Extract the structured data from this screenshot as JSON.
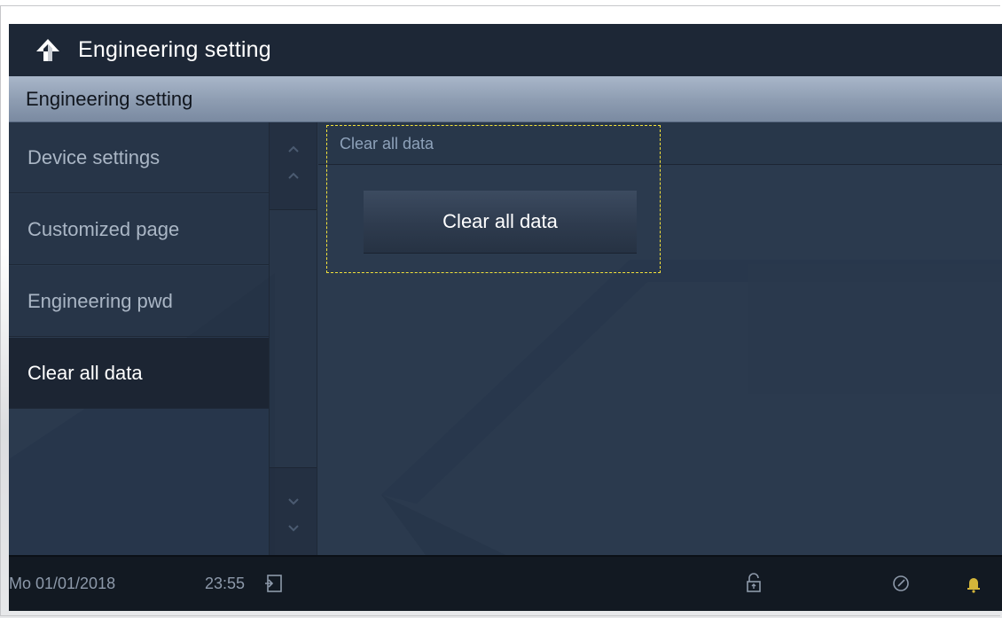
{
  "header": {
    "title": "Engineering setting",
    "back_icon": "back-arrow-icon"
  },
  "subheader": {
    "label": "Engineering setting"
  },
  "sidebar": {
    "items": [
      {
        "label": "Device settings",
        "active": false
      },
      {
        "label": "Customized page",
        "active": false
      },
      {
        "label": "Engineering pwd",
        "active": false
      },
      {
        "label": "Clear all data",
        "active": true
      }
    ]
  },
  "scrollbar": {
    "up_icon": "chevron-up-icon",
    "down_icon": "chevron-down-icon"
  },
  "panel": {
    "header": "Clear all data",
    "button_label": "Clear all data",
    "highlight_color": "#f4e23a"
  },
  "statusbar": {
    "date": "Mo 01/01/2018",
    "time": "23:55",
    "icons": [
      "exit-icon",
      "unlock-icon",
      "clock-icon",
      "bell-icon"
    ]
  },
  "colors": {
    "title_bg": "#1d2736",
    "content_bg": "#2b3a4e",
    "subheader_bg": "#8d9cb1",
    "status_bg": "#121922",
    "active_item_bg": "#1c2533"
  }
}
